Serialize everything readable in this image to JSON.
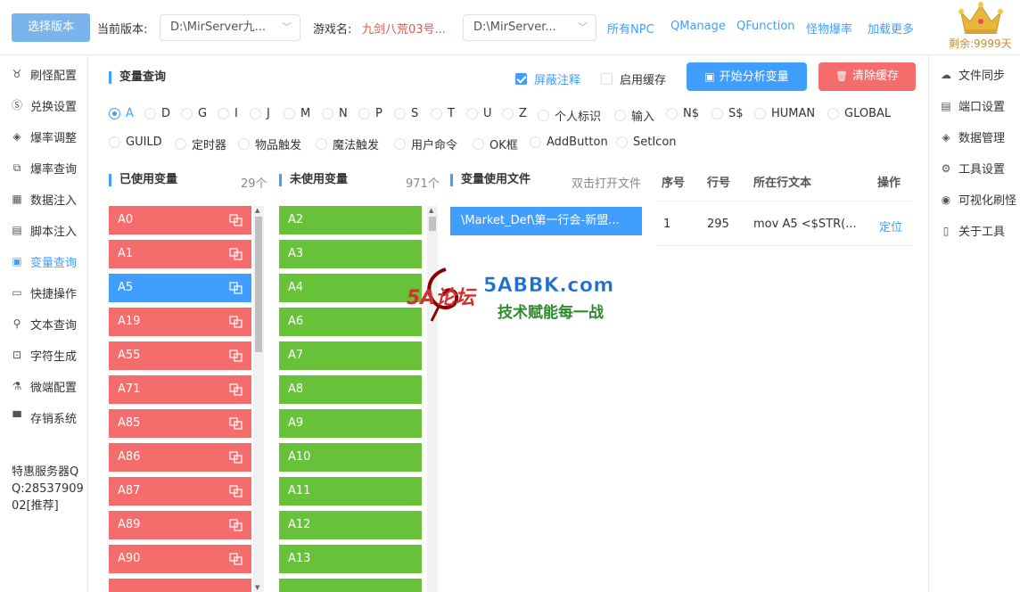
{
  "header": {
    "select_version_button": "选择版本",
    "current_version_label": "当前版本:",
    "current_version_value": "D:\\MirServer九...",
    "game_name_label": "游戏名:",
    "game_name_value": "九剑八荒03号...",
    "path_select_value": "D:\\MirServer...",
    "links": [
      "所有NPC",
      "QManage",
      "QFunction",
      "怪物爆率",
      "加载更多"
    ],
    "remaining": "剩余:9999天"
  },
  "left_nav": {
    "items": [
      {
        "label": "刷怪配置",
        "icon": "monster-icon"
      },
      {
        "label": "兑换设置",
        "icon": "coin-icon"
      },
      {
        "label": "爆率调整",
        "icon": "cube-icon"
      },
      {
        "label": "爆率查询",
        "icon": "copy-icon"
      },
      {
        "label": "数据注入",
        "icon": "grid-icon"
      },
      {
        "label": "脚本注入",
        "icon": "script-icon"
      },
      {
        "label": "变量查询",
        "icon": "query-icon",
        "active": true
      },
      {
        "label": "快捷操作",
        "icon": "folder-icon"
      },
      {
        "label": "文本查询",
        "icon": "search-icon"
      },
      {
        "label": "字符生成",
        "icon": "lock-icon"
      },
      {
        "label": "微端配置",
        "icon": "microscope-icon"
      },
      {
        "label": "存销系统",
        "icon": "store-icon"
      }
    ],
    "promo": "特惠服务器QQ:2853790902[推荐]"
  },
  "right_nav": {
    "items": [
      {
        "label": "文件同步",
        "icon": "cloud-sync-icon"
      },
      {
        "label": "端口设置",
        "icon": "port-icon"
      },
      {
        "label": "数据管理",
        "icon": "cube-icon"
      },
      {
        "label": "工具设置",
        "icon": "gear-icon"
      },
      {
        "label": "可视化刷怪",
        "icon": "eye-icon"
      },
      {
        "label": "关于工具",
        "icon": "document-icon"
      }
    ]
  },
  "main": {
    "title": "变量查询",
    "mask_comments_label": "屏蔽注释",
    "mask_comments_checked": true,
    "enable_cache_label": "启用缓存",
    "enable_cache_checked": false,
    "analyze_button": "开始分析变量",
    "clear_cache_button": "清除缓存",
    "radio_options": [
      "A",
      "D",
      "G",
      "I",
      "J",
      "M",
      "N",
      "P",
      "S",
      "T",
      "U",
      "Z",
      "个人标识",
      "输入",
      "N$",
      "S$",
      "HUMAN",
      "GLOBAL",
      "GUILD",
      "定时器",
      "物品触发",
      "魔法触发",
      "用户命令",
      "OK框",
      "AddButton",
      "SetIcon"
    ],
    "radio_selected": "A",
    "used_vars": {
      "title": "已使用变量",
      "count": "29个",
      "items": [
        "A0",
        "A1",
        "A5",
        "A19",
        "A55",
        "A71",
        "A85",
        "A86",
        "A87",
        "A89",
        "A90"
      ],
      "selected": "A5"
    },
    "unused_vars": {
      "title": "未使用变量",
      "count": "971个",
      "items": [
        "A2",
        "A3",
        "A4",
        "A6",
        "A7",
        "A8",
        "A9",
        "A10",
        "A11",
        "A12",
        "A13"
      ]
    },
    "files": {
      "title": "变量使用文件",
      "hint": "双击打开文件",
      "items": [
        "\\Market_Def\\第一行会-新盟..."
      ]
    },
    "table": {
      "headers": [
        "序号",
        "行号",
        "所在行文本",
        "操作"
      ],
      "rows": [
        {
          "index": "1",
          "line": "295",
          "text": "mov A5 <$STR(...",
          "action": "定位"
        }
      ]
    }
  },
  "watermark": {
    "brand": "5A论坛",
    "site": "5ABBK.com",
    "slogan": "技术赋能每一战"
  },
  "colors": {
    "primary": "#409eff",
    "danger": "#f56c6c",
    "success": "#67c23a",
    "version_button": "#79b4ec"
  }
}
